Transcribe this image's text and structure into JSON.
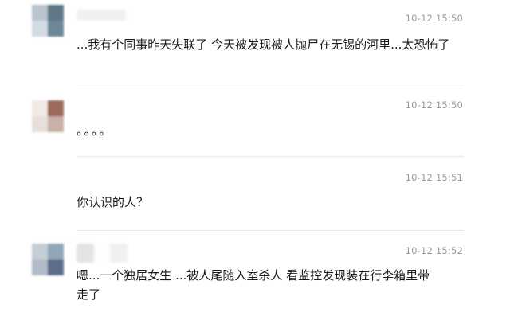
{
  "messages": [
    {
      "time": "10-12 15:50",
      "text": "...我有个同事昨天失联了 今天被发现被人抛尸在无锡的河里...太恐怖了",
      "avatar_colors": [
        "#b9c4cf",
        "#5f7787",
        "#d3dbe2",
        "#6c8796"
      ]
    },
    {
      "time": "10-12 15:50",
      "text": "。。。。",
      "avatar_colors": [
        "#f1e9e6",
        "#9b6a5c",
        "#e8dfdb",
        "#c9b1a8"
      ]
    },
    {
      "time": "10-12 15:51",
      "text": "你认识的人？"
    },
    {
      "time": "10-12 15:52",
      "text": "嗯...一个独居女生 ...被人尾随入室杀人 看监控发现装在行李箱里带走了",
      "avatar_colors": [
        "#c5cdd6",
        "#8fa7b9",
        "#b2bcc9",
        "#5b6d8b"
      ]
    }
  ]
}
